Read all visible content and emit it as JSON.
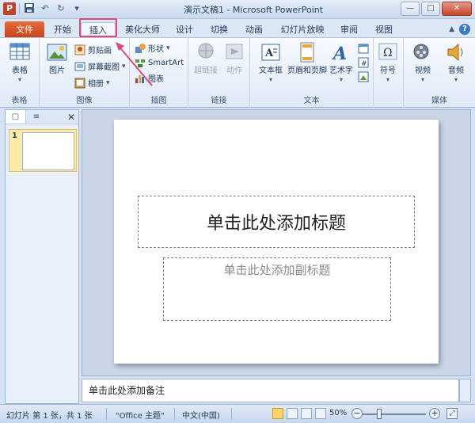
{
  "window": {
    "title": "演示文稿1 - Microsoft PowerPoint",
    "app_icon": "P",
    "controls": {
      "minimize": "—",
      "maximize": "□",
      "close": "✕"
    }
  },
  "tabs": {
    "file": "文件",
    "items": [
      "开始",
      "插入",
      "美化大师",
      "设计",
      "切换",
      "动画",
      "幻灯片放映",
      "审阅",
      "视图"
    ],
    "active": "插入",
    "help": "?"
  },
  "ribbon": {
    "groups": {
      "table": {
        "label": "表格",
        "buttons": {
          "table": "表格"
        }
      },
      "images": {
        "label": "图像",
        "buttons": {
          "picture": "图片",
          "clipart": "剪贴画",
          "screenshot": "屏幕截图",
          "album": "相册"
        }
      },
      "illustrations": {
        "label": "插图",
        "buttons": {
          "shapes": "形状",
          "smartart": "SmartArt",
          "chart": "图表"
        }
      },
      "links": {
        "label": "链接",
        "buttons": {
          "hyperlink": "超链接",
          "action": "动作"
        }
      },
      "text": {
        "label": "文本",
        "buttons": {
          "textbox": "文本框",
          "header_footer": "页眉和页脚",
          "wordart": "艺术字"
        }
      },
      "symbols": {
        "label": "",
        "buttons": {
          "symbol": "符号"
        }
      },
      "media": {
        "label": "媒体",
        "buttons": {
          "video": "视频",
          "audio": "音频"
        }
      }
    }
  },
  "left_pane": {
    "slide_number": "1",
    "close": "✕"
  },
  "slide": {
    "title_placeholder": "单击此处添加标题",
    "subtitle_placeholder": "单击此处添加副标题"
  },
  "notes": {
    "placeholder": "单击此处添加备注"
  },
  "statusbar": {
    "slide_info": "幻灯片 第 1 张，共 1 张",
    "theme": "\"Office 主题\"",
    "language": "中文(中国)",
    "zoom": "50%"
  },
  "colors": {
    "file_tab": "#c4421c",
    "highlight": "#e0477a",
    "selected_thumb": "#fde9a8"
  }
}
